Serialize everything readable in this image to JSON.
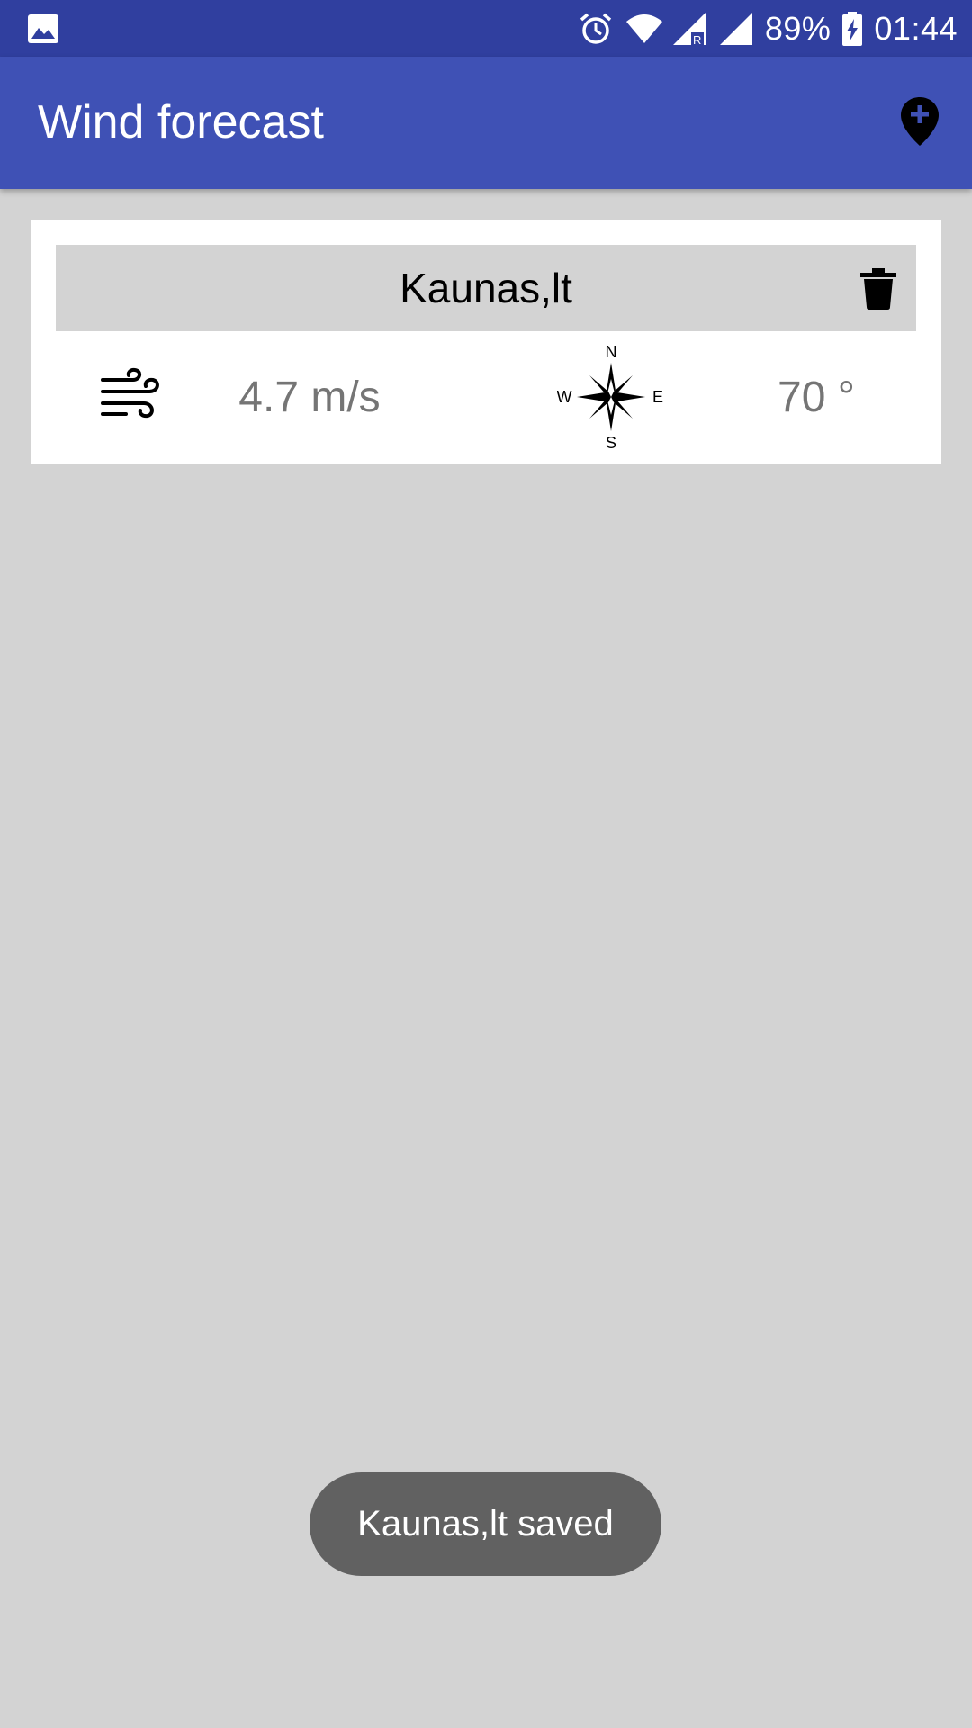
{
  "status_bar": {
    "battery_percent": "89%",
    "time": "01:44",
    "icons": [
      "gallery-icon",
      "alarm-icon",
      "wifi-icon",
      "cell-signal-roaming-icon",
      "cell-signal-icon",
      "battery-charging-icon"
    ]
  },
  "app_bar": {
    "title": "Wind forecast",
    "action_icon": "add-location-icon"
  },
  "locations": [
    {
      "name": "Kaunas,lt",
      "wind_speed": "4.7 m/s",
      "wind_direction": "70 °",
      "compass_labels": {
        "n": "N",
        "s": "S",
        "e": "E",
        "w": "W"
      }
    }
  ],
  "toast": {
    "message": "Kaunas,lt saved"
  },
  "colors": {
    "status_bar": "#303f9f",
    "app_bar": "#3f51b5",
    "background": "#d3d3d3",
    "card": "#ffffff",
    "secondary_text": "#757575",
    "toast": "#616161"
  }
}
